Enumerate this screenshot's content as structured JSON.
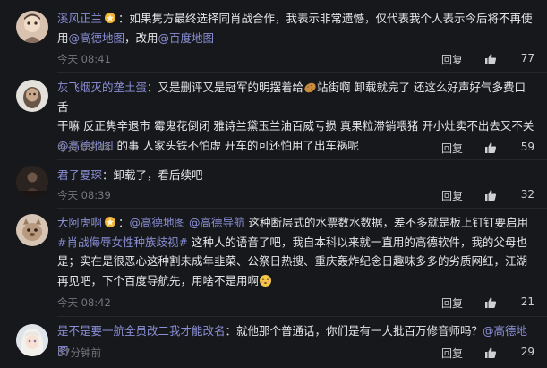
{
  "comments": [
    {
      "username": "溪风正兰",
      "badge": "medal-icon",
      "segments": [
        {
          "t": "text",
          "v": "如果隽方最终选择同肖战合作，我表示非常遗憾，仅代表我个人表示今后将不再使"
        },
        {
          "t": "text",
          "v": "用"
        },
        {
          "t": "link",
          "v": "@高德地图"
        },
        {
          "t": "text",
          "v": "，改用"
        },
        {
          "t": "link",
          "v": "@百度地图"
        }
      ],
      "time": "今天 08:41",
      "reply": "回复",
      "likes": "77"
    },
    {
      "username": "灰飞烟灭的垄土蛋",
      "segments": [
        {
          "t": "text",
          "v": "又是删评又是冠军的明摆着给"
        },
        {
          "t": "text",
          "v": "站街啊 卸载就完了 还这么好声好气多费口舌"
        },
        {
          "t": "text",
          "v": "干嘛 反正隽辛退市 霉鬼花倒闭 雅诗兰黛玉兰油百威亏损 真果粒滞销喂猪 开小灶卖不出去又不关"
        },
        {
          "t": "link",
          "v": "@高德地图"
        },
        {
          "t": "text",
          "v": " 的事 人家头铁不怕虚 开车的可还怕用了出车祸呢"
        }
      ],
      "time": "今天 08:44",
      "reply": "回复",
      "likes": "59"
    },
    {
      "username": "君子夏琛",
      "segments": [
        {
          "t": "text",
          "v": "卸载了，看后续吧"
        }
      ],
      "time": "今天 08:39",
      "reply": "回复",
      "likes": "32"
    },
    {
      "username": "大阿虎啊",
      "badge": "medal-icon",
      "segments": [
        {
          "t": "link",
          "v": "@高德地图"
        },
        {
          "t": "link",
          "v": " @高德导航"
        },
        {
          "t": "text",
          "v": " 这种断层式的水票数水数据，差不多就是板上钉钉要启用"
        },
        {
          "t": "tag",
          "v": "#肖战侮辱女性种族歧视#"
        },
        {
          "t": "text",
          "v": " 这种人的语音了吧，我自本科以来就一直用的高德软件，我的父母也是；实在是很恶心这种割未成年韭菜、公祭日热搜、重庆轰炸纪念日趣味多多的劣质网红，江湖再见吧，下个百度导航先，用啥不是用啊"
        }
      ],
      "time": "今天 08:42",
      "reply": "回复",
      "likes": "21"
    },
    {
      "username": "是不是要一航全员改二我才能改名",
      "segments": [
        {
          "t": "text",
          "v": "就他那个普通话，你们是有一大批百万修音师吗？"
        },
        {
          "t": "link",
          "v": "@高德地图"
        }
      ],
      "time": "57分钟前",
      "reply": "回复",
      "likes": "29"
    }
  ],
  "colors": {
    "background": "#17181c",
    "username": "#8a8fd6",
    "body_text": "#e6e6ea",
    "meta_text": "#76767e"
  },
  "icons": {
    "like": "thumbs-up-icon",
    "badge": "medal-icon",
    "emoji_potato": "potato-emoji-icon",
    "emoji_face": "blush-emoji-icon"
  }
}
